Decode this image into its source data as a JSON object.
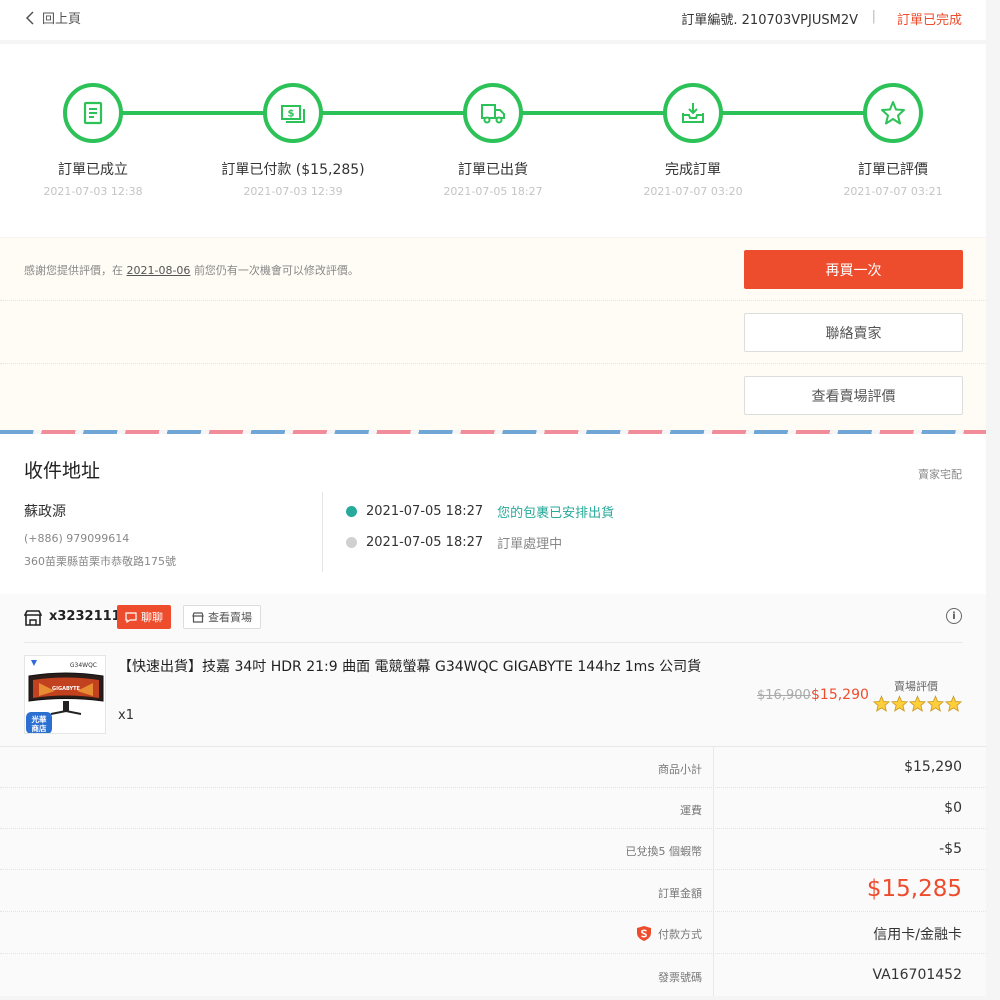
{
  "header": {
    "back_label": "回上頁",
    "order_id": "訂單編號. 210703VPJUSM2V",
    "divider": "|",
    "status": "訂單已完成"
  },
  "progress": {
    "steps": [
      {
        "label": "訂單已成立",
        "time": "2021-07-03 12:38",
        "icon": "receipt-icon"
      },
      {
        "label": "訂單已付款 ($15,285)",
        "time": "2021-07-03 12:39",
        "icon": "money-icon"
      },
      {
        "label": "訂單已出貨",
        "time": "2021-07-05 18:27",
        "icon": "truck-icon"
      },
      {
        "label": "完成訂單",
        "time": "2021-07-07 03:20",
        "icon": "inbox-download-icon"
      },
      {
        "label": "訂單已評價",
        "time": "2021-07-07 03:21",
        "icon": "star-icon"
      }
    ]
  },
  "actions": {
    "review_note_prefix": "感謝您提供評價，在",
    "review_note_date": "2021-08-06",
    "review_note_suffix": "前您仍有一次機會可以修改評價。",
    "buy_again": "再買一次",
    "contact_seller": "聯絡賣家",
    "view_shop_rating": "查看賣場評價"
  },
  "address": {
    "title": "收件地址",
    "carrier": "賣家宅配",
    "name": "蘇政源",
    "phone": "(+886) 979099614",
    "addr": "360苗栗縣苗栗市恭敬路175號",
    "tracking": [
      {
        "time": "2021-07-05 18:27",
        "text": "您的包裹已安排出貨",
        "color": "#26aa99"
      },
      {
        "time": "2021-07-05 18:27",
        "text": "訂單處理中",
        "color": "#888888"
      }
    ]
  },
  "shop": {
    "name": "x3232111",
    "chat": "聊聊",
    "view_shop": "查看賣場",
    "item": {
      "title": "【快速出貨】技嘉 34吋 HDR 21:9 曲面 電競螢幕 G34WQC GIGABYTE 144hz 1ms 公司貨",
      "qty": "x1",
      "thumb_model": "G34WQC",
      "thumb_brand": "GIGABYTE",
      "thumb_badge": "光華商店",
      "price_old": "$16,900",
      "price_new": "$15,290",
      "rating_label": "賣場評價",
      "rating_stars": 5
    }
  },
  "summary": {
    "rows": [
      {
        "label": "商品小計",
        "value": "$15,290"
      },
      {
        "label": "運費",
        "value": "$0"
      },
      {
        "label": "已兌換5 個蝦幣",
        "value": "-$5"
      },
      {
        "label": "訂單金額",
        "value": "$15,285"
      },
      {
        "label": "付款方式",
        "value": "信用卡/金融卡"
      },
      {
        "label": "發票號碼",
        "value": "VA16701452"
      }
    ]
  },
  "colors": {
    "accent": "#ee4d2d",
    "progress_green": "#2dc258",
    "teal": "#26aa99"
  }
}
